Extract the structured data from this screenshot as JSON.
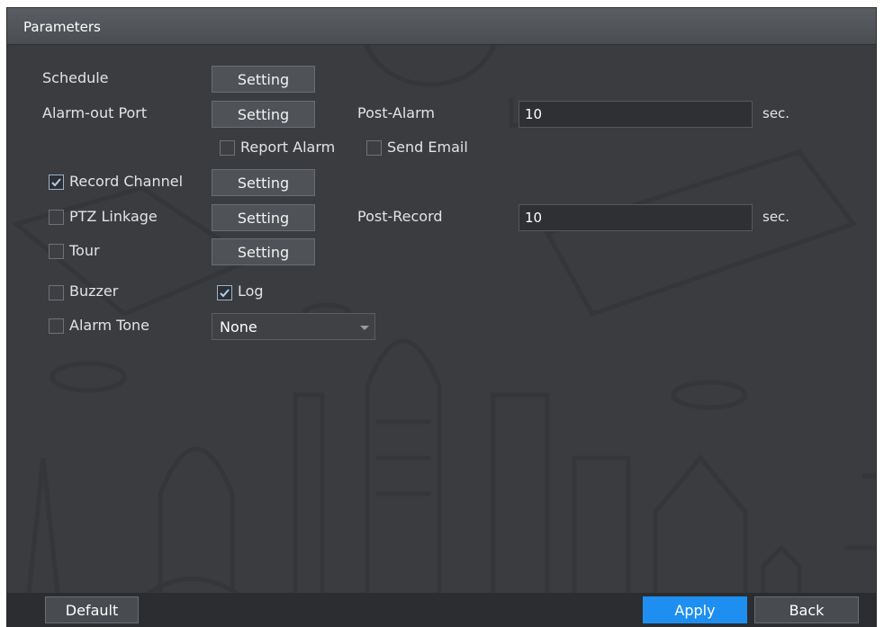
{
  "title": "Parameters",
  "rows": {
    "schedule": {
      "label": "Schedule",
      "button": "Setting"
    },
    "alarm_out_port": {
      "label": "Alarm-out Port",
      "button": "Setting"
    },
    "post_alarm": {
      "label": "Post-Alarm",
      "value": "10",
      "unit": "sec."
    },
    "report_alarm": {
      "label": "Report Alarm",
      "checked": false
    },
    "send_email": {
      "label": "Send Email",
      "checked": false
    },
    "record_channel": {
      "label": "Record Channel",
      "button": "Setting",
      "checked": true
    },
    "ptz_linkage": {
      "label": "PTZ Linkage",
      "button": "Setting",
      "checked": false
    },
    "post_record": {
      "label": "Post-Record",
      "value": "10",
      "unit": "sec."
    },
    "tour": {
      "label": "Tour",
      "button": "Setting",
      "checked": false
    },
    "buzzer": {
      "label": "Buzzer",
      "checked": false
    },
    "log": {
      "label": "Log",
      "checked": true
    },
    "alarm_tone": {
      "label": "Alarm Tone",
      "selected": "None",
      "checked": false
    }
  },
  "footer": {
    "default_label": "Default",
    "apply_label": "Apply",
    "back_label": "Back"
  },
  "colors": {
    "accent": "#1e8ff0",
    "panel_bg": "#3a3c40",
    "checkmark": "#a9d1f0"
  }
}
